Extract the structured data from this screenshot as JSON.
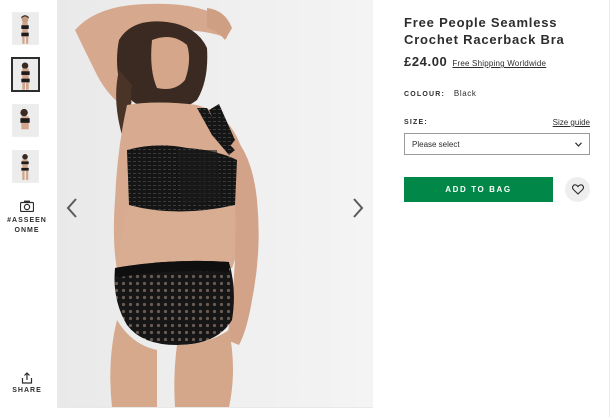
{
  "thumbnails": [
    {
      "name": "thumb-front-view",
      "active": false
    },
    {
      "name": "thumb-back-view",
      "active": true
    },
    {
      "name": "thumb-side-view",
      "active": false
    },
    {
      "name": "thumb-full-view",
      "active": false
    }
  ],
  "as_seen_on_me": {
    "label": "#ASSEENONME",
    "icon": "camera-icon"
  },
  "share": {
    "label": "SHARE",
    "icon": "share-icon"
  },
  "gallery": {
    "prev_icon": "chevron-left-icon",
    "next_icon": "chevron-right-icon"
  },
  "product": {
    "title": "Free People Seamless Crochet Racerback Bra",
    "price": "£24.00",
    "shipping_link": "Free Shipping Worldwide",
    "colour_label": "COLOUR:",
    "colour_value": "Black",
    "size_label": "SIZE:",
    "size_guide": "Size guide",
    "size_select_placeholder": "Please select",
    "add_to_bag": "ADD TO BAG",
    "save_icon": "heart-icon"
  },
  "colors": {
    "accent": "#018849",
    "text": "#2d2d2d",
    "background": "#ffffff",
    "photo_bg": "#f1f1f1"
  }
}
